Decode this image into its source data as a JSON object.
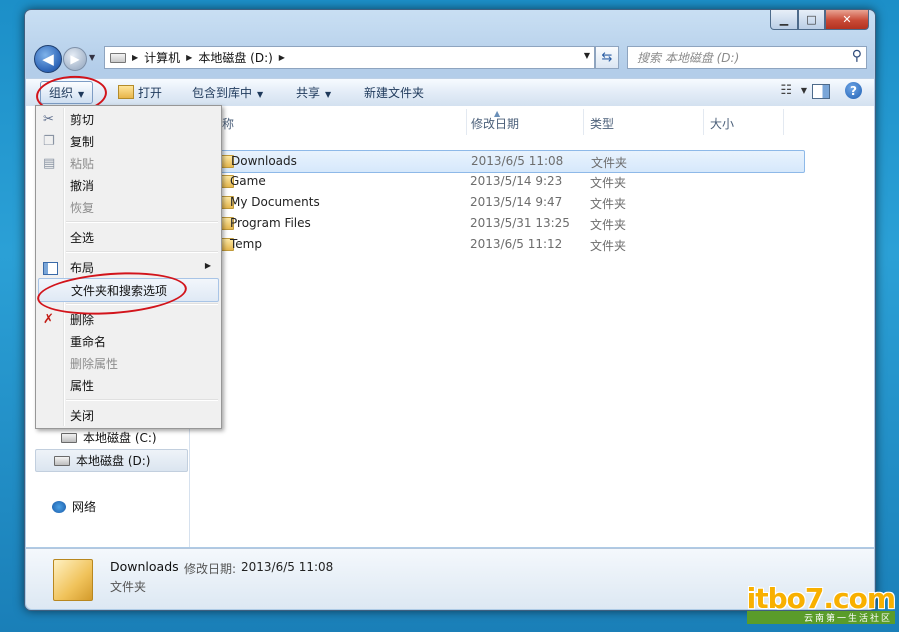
{
  "window": {
    "controls": {
      "minimize": "▁",
      "maximize": "□",
      "close": "✕"
    }
  },
  "nav": {
    "back_icon": "back-arrow-icon",
    "forward_icon": "forward-arrow-icon",
    "breadcrumbs": [
      "计算机",
      "本地磁盘 (D:)"
    ],
    "search_placeholder": "搜索 本地磁盘 (D:)"
  },
  "toolbar": {
    "organize": "组织",
    "open": "打开",
    "include_in_library": "包含到库中",
    "share": "共享",
    "new_folder": "新建文件夹"
  },
  "columns": {
    "name": "名称",
    "date": "修改日期",
    "type": "类型",
    "size": "大小"
  },
  "files": [
    {
      "name": "Downloads",
      "date": "2013/6/5 11:08",
      "type": "文件夹",
      "selected": true
    },
    {
      "name": "Game",
      "date": "2013/5/14 9:23",
      "type": "文件夹",
      "selected": false
    },
    {
      "name": "My Documents",
      "date": "2013/5/14 9:47",
      "type": "文件夹",
      "selected": false
    },
    {
      "name": "Program Files",
      "date": "2013/5/31 13:25",
      "type": "文件夹",
      "selected": false
    },
    {
      "name": "Temp",
      "date": "2013/6/5 11:12",
      "type": "文件夹",
      "selected": false
    }
  ],
  "navpane": {
    "drive_c": "本地磁盘 (C:)",
    "drive_d": "本地磁盘 (D:)",
    "network": "网络"
  },
  "menu": {
    "cut": "剪切",
    "copy": "复制",
    "paste": "粘贴",
    "undo": "撤消",
    "redo": "恢复",
    "select_all": "全选",
    "layout": "布局",
    "folder_options": "文件夹和搜索选项",
    "delete": "删除",
    "rename": "重命名",
    "remove_properties": "删除属性",
    "properties": "属性",
    "close": "关闭"
  },
  "details": {
    "name": "Downloads",
    "modified_label": "修改日期:",
    "modified": "2013/6/5 11:08",
    "type": "文件夹"
  },
  "watermark": {
    "logo": "itbo7.com",
    "subtitle": "云南第一生活社区"
  },
  "colors": {
    "annotation_ring": "#d2141b",
    "selection": "#d6e8fb",
    "desktop": "#2ba0d6"
  }
}
